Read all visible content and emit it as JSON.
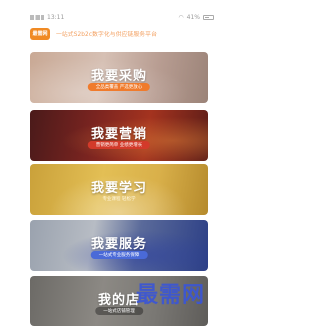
{
  "status_bar": {
    "carrier": "中国移动",
    "time": "13:11",
    "battery": "41%"
  },
  "header": {
    "logo_text": "最需网",
    "slogan": "一站式S2b2c数字化与供应链服务平台"
  },
  "cards": [
    {
      "title": "我要采购",
      "subtitle": "全品类覆盖  严选更放心"
    },
    {
      "title": "我要营销",
      "subtitle": "营销更简单  业绩更增长"
    },
    {
      "title": "我要学习",
      "subtitle": "专业课程  轻松学"
    },
    {
      "title": "我要服务",
      "subtitle": "一站式专业服务保障"
    },
    {
      "title": "我的店",
      "subtitle": "一站式店铺管理"
    }
  ],
  "watermark": "最需网"
}
